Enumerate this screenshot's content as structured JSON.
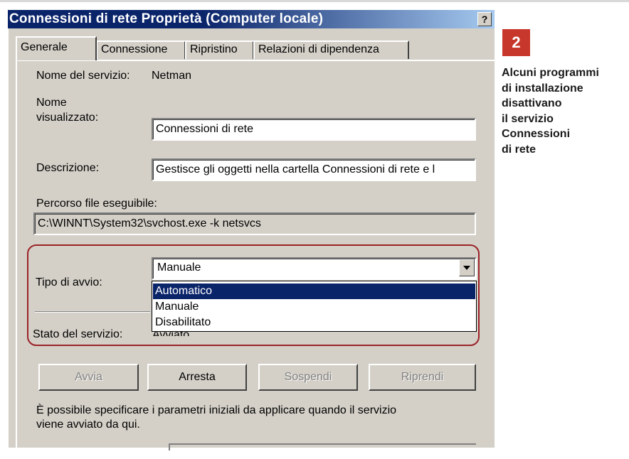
{
  "window": {
    "title": "Connessioni di rete Proprietà (Computer locale)",
    "help_label": "?"
  },
  "tabs": [
    {
      "label": "Generale",
      "active": true
    },
    {
      "label": "Connessione",
      "active": false
    },
    {
      "label": "Ripristino",
      "active": false
    },
    {
      "label": "Relazioni di dipendenza",
      "active": false
    }
  ],
  "general": {
    "service_name_label": "Nome del servizio:",
    "service_name_value": "Netman",
    "display_name_label_1": "Nome",
    "display_name_label_2": "visualizzato:",
    "display_name_value": "Connessioni di rete",
    "description_label": "Descrizione:",
    "description_value": "Gestisce gli oggetti nella cartella Connessioni di rete e l",
    "path_label": "Percorso file eseguibile:",
    "path_value": "C:\\WINNT\\System32\\svchost.exe -k netsvcs",
    "startup_type_label": "Tipo di avvio:",
    "startup_type_value": "Manuale",
    "startup_options": [
      {
        "label": "Automatico",
        "highlighted": true
      },
      {
        "label": "Manuale",
        "highlighted": false
      },
      {
        "label": "Disabilitato",
        "highlighted": false
      }
    ],
    "service_status_label": "Stato del servizio:",
    "service_status_value": "Avviato",
    "buttons": {
      "start": "Avvia",
      "stop": "Arresta",
      "pause": "Sospendi",
      "resume": "Riprendi"
    },
    "note_line_1": "È possibile specificare i parametri iniziali da applicare quando il servizio",
    "note_line_2": "viene avviato da qui."
  },
  "annotation": {
    "number": "2",
    "lines": [
      "Alcuni programmi",
      "di installazione",
      "disattivano",
      "il servizio",
      "Connessioni",
      "di rete"
    ],
    "badge_color": "#c8372b",
    "highlight_color": "#9b2226"
  },
  "colors": {
    "title_bar": "#0a246a",
    "dialog_face": "#d4d0c8",
    "selection": "#0a246a"
  }
}
